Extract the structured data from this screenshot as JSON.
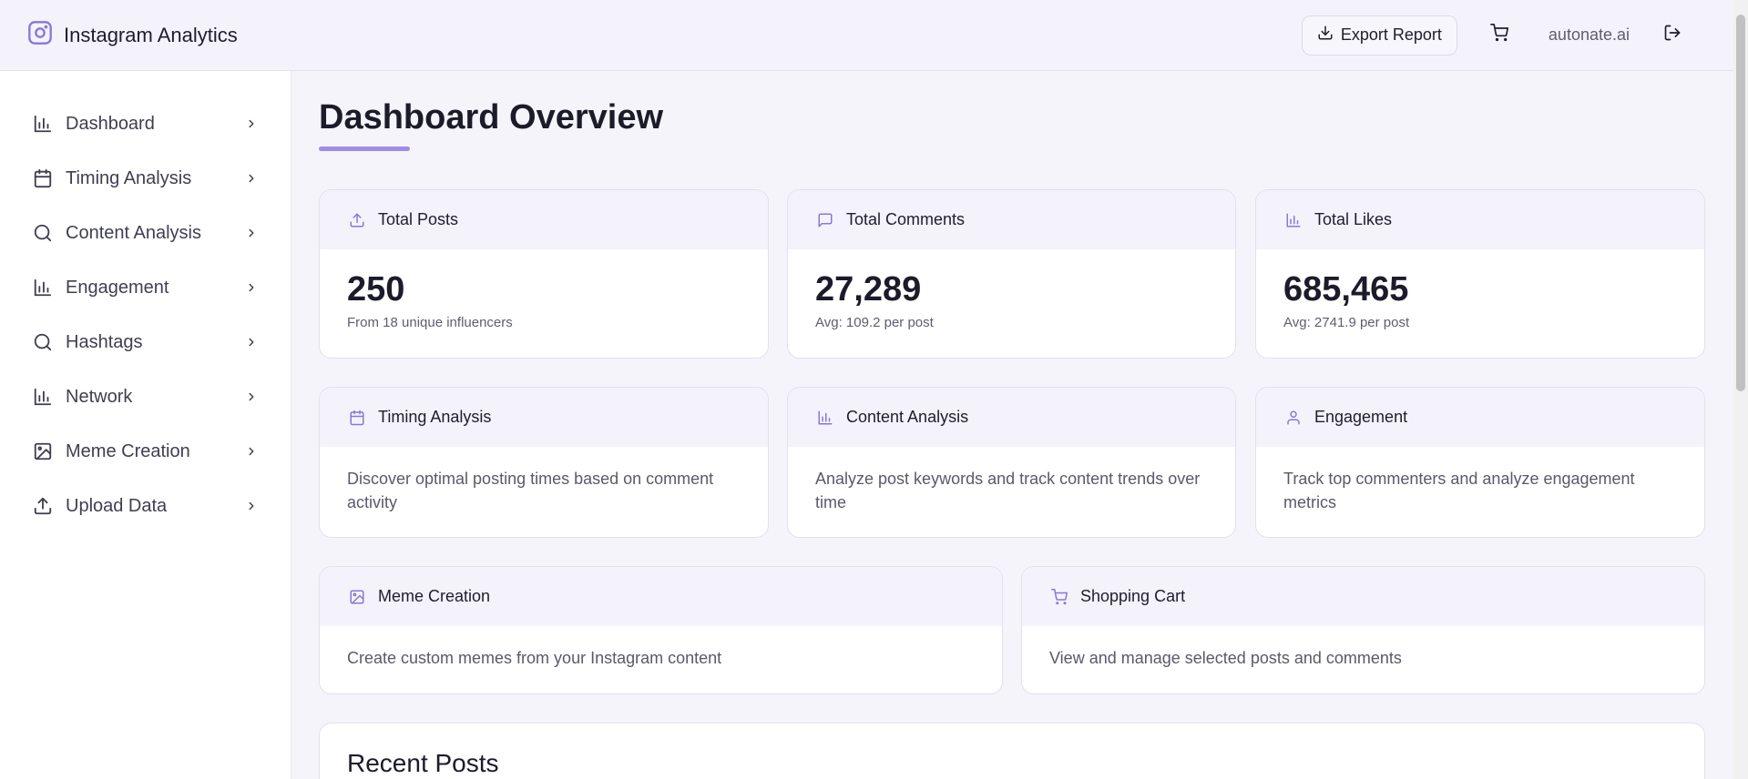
{
  "header": {
    "app_title": "Instagram Analytics",
    "export_label": "Export Report",
    "user": "autonate.ai"
  },
  "sidebar": {
    "items": [
      {
        "label": "Dashboard",
        "icon": "bar-chart-icon"
      },
      {
        "label": "Timing Analysis",
        "icon": "calendar-icon"
      },
      {
        "label": "Content Analysis",
        "icon": "search-icon"
      },
      {
        "label": "Engagement",
        "icon": "bar-chart-icon"
      },
      {
        "label": "Hashtags",
        "icon": "search-icon"
      },
      {
        "label": "Network",
        "icon": "bar-chart-icon"
      },
      {
        "label": "Meme Creation",
        "icon": "image-icon"
      },
      {
        "label": "Upload Data",
        "icon": "upload-icon"
      }
    ]
  },
  "main": {
    "title": "Dashboard Overview",
    "stats": [
      {
        "label": "Total Posts",
        "value": "250",
        "sub": "From 18 unique influencers",
        "icon": "upload-icon"
      },
      {
        "label": "Total Comments",
        "value": "27,289",
        "sub": "Avg: 109.2 per post",
        "icon": "message-icon"
      },
      {
        "label": "Total Likes",
        "value": "685,465",
        "sub": "Avg: 2741.9 per post",
        "icon": "bar-chart-icon"
      }
    ],
    "features": [
      {
        "label": "Timing Analysis",
        "desc": "Discover optimal posting times based on comment activity",
        "icon": "calendar-icon"
      },
      {
        "label": "Content Analysis",
        "desc": "Analyze post keywords and track content trends over time",
        "icon": "bar-chart-icon"
      },
      {
        "label": "Engagement",
        "desc": "Track top commenters and analyze engagement metrics",
        "icon": "user-icon"
      }
    ],
    "tools": [
      {
        "label": "Meme Creation",
        "desc": "Create custom memes from your Instagram content",
        "icon": "image-icon"
      },
      {
        "label": "Shopping Cart",
        "desc": "View and manage selected posts and comments",
        "icon": "cart-icon"
      }
    ],
    "recent_title": "Recent Posts"
  },
  "colors": {
    "accent": "#a08ce6",
    "icon_accent": "#8b76d8",
    "background": "#f5f4fb"
  }
}
